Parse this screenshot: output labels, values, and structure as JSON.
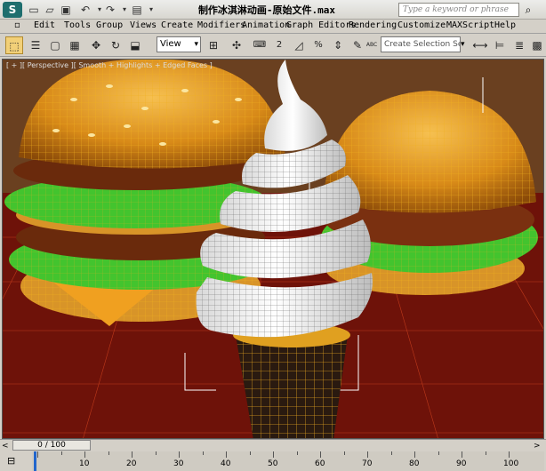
{
  "window": {
    "title": "制作冰淇淋动画-原始文件.max",
    "logo": "3ds"
  },
  "quick_access": [
    "new-icon",
    "open-icon",
    "save-icon",
    "undo-icon",
    "redo-icon",
    "project-icon"
  ],
  "search": {
    "placeholder": "Type a keyword or phrase"
  },
  "menus": [
    "Edit",
    "Tools",
    "Group",
    "Views",
    "Create",
    "Modifiers",
    "Animation",
    "Graph Editors",
    "Rendering",
    "Customize",
    "MAXScript",
    "Help"
  ],
  "toolbar": {
    "view_select": "View",
    "selection_set_placeholder": "Create Selection Se",
    "snap_number": "2",
    "percent_symbol": "%",
    "abc_label": "ABC"
  },
  "viewport": {
    "label": "[ + ][ Perspective ][ Smooth + Highlights + Edged Faces ]",
    "colors": {
      "background": "#6e1209",
      "bun": "#e8a028",
      "lettuce": "#3ec02a",
      "patty": "#6a3010",
      "cream": "#f4f4f4",
      "cone": "#2a1a10",
      "grid": "#ff5a2a"
    }
  },
  "timeline": {
    "frame_display": "0 / 100",
    "current_frame": 0,
    "range": [
      0,
      100
    ],
    "ticks": [
      "0",
      "10",
      "20",
      "30",
      "40",
      "50",
      "60",
      "70",
      "80",
      "90",
      "100"
    ]
  }
}
